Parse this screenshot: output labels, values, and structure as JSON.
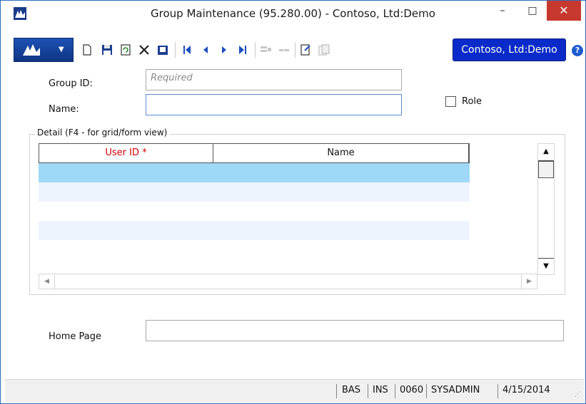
{
  "window": {
    "title": "Group Maintenance (95.280.00) - Contoso, Ltd:Demo",
    "minimize_glyph": "–",
    "maximize_glyph": "□",
    "close_glyph": "✕"
  },
  "toolbar": {
    "company_label": "Contoso, Ltd:Demo",
    "help_glyph": "?",
    "icons": [
      "new-icon",
      "save-icon",
      "refresh-icon",
      "delete-icon",
      "print-icon",
      "first-record-icon",
      "previous-record-icon",
      "next-record-icon",
      "last-record-icon",
      "insert-row-icon",
      "delete-row-icon",
      "notes-icon",
      "copy-icon"
    ]
  },
  "form": {
    "group_id_label": "Group ID:",
    "group_id_placeholder": "Required",
    "name_label": "Name:",
    "name_value": "",
    "role_label": "Role",
    "role_checked": false,
    "home_page_label": "Home Page",
    "home_page_value": ""
  },
  "detail": {
    "legend": "Detail (F4 - for grid/form view)",
    "columns": [
      "User ID *",
      "Name"
    ],
    "required_color": "#d00000",
    "selected_row_color": "#9fd9f7"
  },
  "statusbar": {
    "items": [
      "BAS",
      "INS",
      "0060",
      "SYSADMIN",
      "4/15/2014"
    ]
  },
  "colors": {
    "accent": "#0a2bc9",
    "close": "#c7382f",
    "logo": "#1a3a8a"
  }
}
